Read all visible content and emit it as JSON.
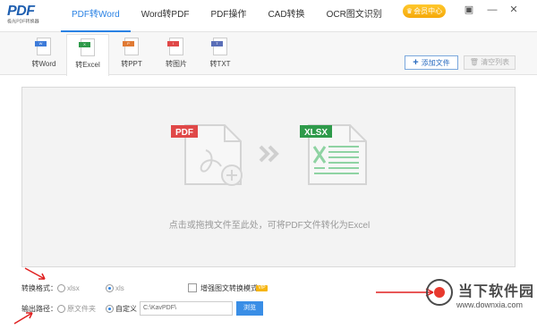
{
  "app": {
    "logo_big": "PDF",
    "logo_small": "极光PDF转换器"
  },
  "nav": {
    "items": [
      "PDF转Word",
      "Word转PDF",
      "PDF操作",
      "CAD转换",
      "OCR图文识别"
    ],
    "active": 0
  },
  "vip_badge": "会员中心",
  "window_controls": [
    "menu-icon",
    "minimize-icon",
    "close-icon"
  ],
  "subtabs": [
    {
      "label": "转Word",
      "tag": "W",
      "color": "#3d7bd9"
    },
    {
      "label": "转Excel",
      "tag": "X",
      "color": "#2e9a4a"
    },
    {
      "label": "转PPT",
      "tag": "P",
      "color": "#e07a34"
    },
    {
      "label": "转图片",
      "tag": "I",
      "color": "#e04848"
    },
    {
      "label": "转TXT",
      "tag": "T",
      "color": "#5a6fb8"
    }
  ],
  "subtab_active": 1,
  "actions": {
    "add": "添加文件",
    "clear": "清空列表"
  },
  "drop": {
    "hint": "点击或拖拽文件至此处，可将PDF文件转化为Excel",
    "from_tag": "PDF",
    "to_tag": "XLSX",
    "from_color": "#e04848",
    "to_color": "#2e9a4a"
  },
  "format": {
    "label": "转换格式：",
    "options": [
      "xlsx",
      "xls"
    ],
    "selected": 1,
    "enhance_label": "增强图文转换模式",
    "vip_tag": "VIP"
  },
  "output": {
    "label": "输出路径：",
    "options": [
      "原文件夹",
      "自定义"
    ],
    "selected": 1,
    "path": "C:\\KavPDF\\",
    "browse": "浏览"
  },
  "watermark": {
    "text": "当下软件园",
    "url": "www.downxia.com"
  },
  "colors": {
    "accent": "#2a82e4",
    "annotation_arrow": "#e02020"
  }
}
